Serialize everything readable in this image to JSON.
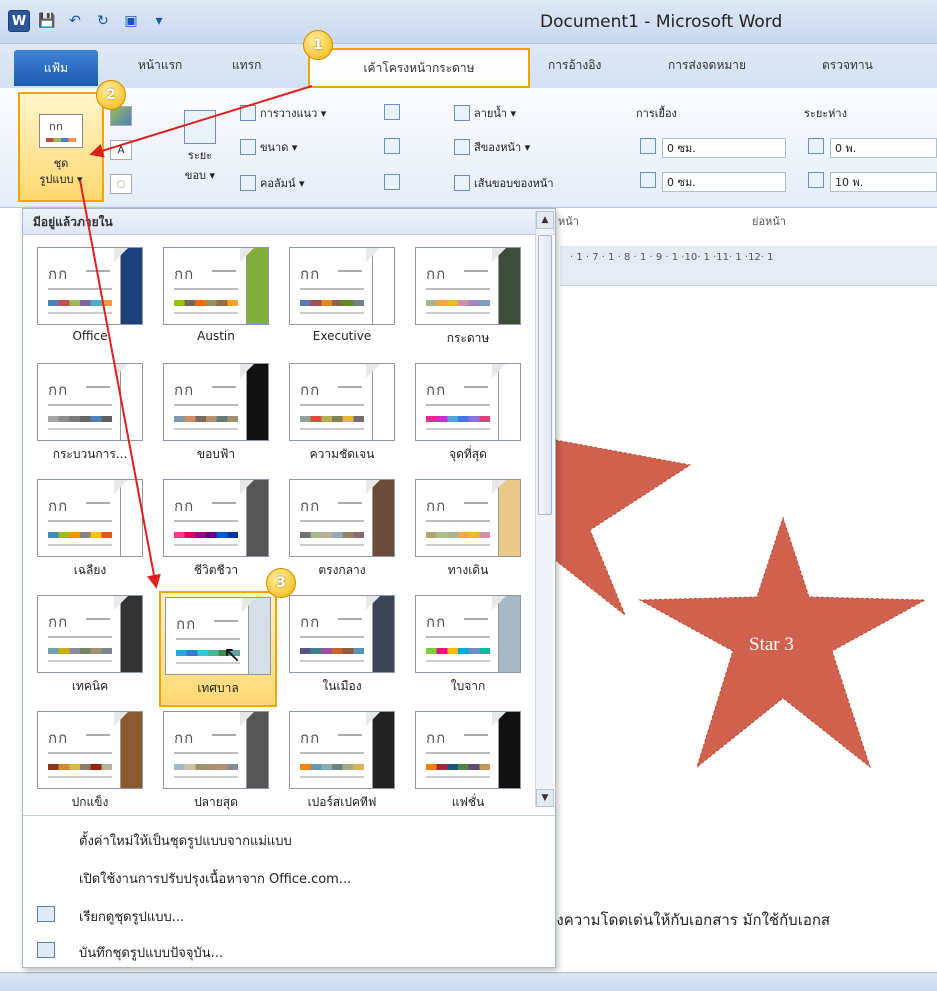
{
  "window": {
    "title": "Document1 - Microsoft Word",
    "app_icon": "W"
  },
  "tabs": {
    "file": "แฟ้ม",
    "home": "หน้าแรก",
    "insert": "แทรก",
    "page_layout": "เค้าโครงหน้ากระดาษ",
    "references": "การอ้างอิง",
    "mailings": "การส่งจดหมาย",
    "review": "ตรวจทาน"
  },
  "ribbon": {
    "themes_label": "ชุด รูปแบบ",
    "themes_line1": "ชุด",
    "themes_line2": "รูปแบบ ▾",
    "margins": "ระยะ ขอบ",
    "margins_line1": "ระยะ",
    "margins_line2": "ขอบ ▾",
    "orientation": "การวางแนว ▾",
    "size": "ขนาด ▾",
    "columns": "คอลัมน์ ▾",
    "watermark": "ลายน้ำ ▾",
    "page_color": "สีของหน้า ▾",
    "page_borders": "เส้นขอบของหน้า",
    "indent_label": "การเยื้อง",
    "spacing_label": "ระยะห่าง",
    "indent_left": "0 ซม.",
    "indent_right": "0 ซม.",
    "space_before": "0 พ.",
    "space_after": "10 พ.",
    "group_page_background_tail": "หน้า",
    "group_paragraph": "ย่อหน้า"
  },
  "gallery": {
    "header": "มีอยู่แล้วภายใน",
    "themes": [
      {
        "name": "Office",
        "fold": "#1f3f7a",
        "swatch": [
          "#4f81bd",
          "#c0504d",
          "#9bbb59",
          "#8064a2",
          "#4bacc6",
          "#f79646"
        ]
      },
      {
        "name": "Austin",
        "fold": "#7fae3a",
        "swatch": [
          "#94c600",
          "#71685a",
          "#ff6700",
          "#909465",
          "#956b43",
          "#fea022"
        ]
      },
      {
        "name": "Executive",
        "fold": "#ffffff",
        "swatch": [
          "#6076b4",
          "#9c5252",
          "#e68422",
          "#846648",
          "#63891f",
          "#758085"
        ]
      },
      {
        "name": "กระดาษ",
        "fold": "#3e4a3a",
        "swatch": [
          "#a5b592",
          "#f3a447",
          "#e7bc29",
          "#d092a7",
          "#9c85c0",
          "#809ec2"
        ]
      },
      {
        "name": "กระบวนการ...",
        "fold": "#ffffff",
        "swatch": [
          "#a5a5a5",
          "#8c8c8c",
          "#7a7a7a",
          "#666666",
          "#4f81bd",
          "#5f5f5f"
        ]
      },
      {
        "name": "ขอบฟ้า",
        "fold": "#111111",
        "swatch": [
          "#7e97ad",
          "#cc8e60",
          "#7a6a60",
          "#b4936d",
          "#67787b",
          "#9d936f"
        ]
      },
      {
        "name": "ความชัดเจน",
        "fold": "#ffffff",
        "swatch": [
          "#93a299",
          "#cf543f",
          "#b5ae53",
          "#848058",
          "#e8b54d",
          "#786c71"
        ]
      },
      {
        "name": "จุดที่สุด",
        "fold": "#ffffff",
        "swatch": [
          "#e32d91",
          "#c830cc",
          "#4ea6dc",
          "#4775e7",
          "#8971e1",
          "#d54773"
        ]
      },
      {
        "name": "เฉลียง",
        "fold": "#ffffff",
        "swatch": [
          "#418ab3",
          "#a6b727",
          "#f69200",
          "#838383",
          "#fec306",
          "#df5327"
        ]
      },
      {
        "name": "ชีวิตชีวา",
        "fold": "#555555",
        "swatch": [
          "#ff388c",
          "#e40059",
          "#9c007f",
          "#68007f",
          "#005bd3",
          "#00349e"
        ]
      },
      {
        "name": "ตรงกลาง",
        "fold": "#6b4c3a",
        "swatch": [
          "#6f6f74",
          "#a7b789",
          "#beae98",
          "#92a9b9",
          "#9c8265",
          "#8d6974"
        ]
      },
      {
        "name": "ทางเดิน",
        "fold": "#e8c98a",
        "swatch": [
          "#b6a272",
          "#b0bf8f",
          "#a5b592",
          "#f3a447",
          "#e7bc29",
          "#d092a7"
        ]
      },
      {
        "name": "เทคนิค",
        "fold": "#333333",
        "swatch": [
          "#6ea0b0",
          "#ccaf0a",
          "#8d89a4",
          "#748560",
          "#9e9273",
          "#7e848d"
        ]
      },
      {
        "name": "เทศบาล",
        "fold": "#d6dde5",
        "swatch": [
          "#1cade4",
          "#2683c6",
          "#27ced7",
          "#42ba97",
          "#3e8853",
          "#62a39f"
        ]
      },
      {
        "name": "ในเมือง",
        "fold": "#3a4656",
        "swatch": [
          "#53548a",
          "#438086",
          "#a04da3",
          "#c4652d",
          "#8b5d3d",
          "#5c92b5"
        ]
      },
      {
        "name": "ใบจาก",
        "fold": "#a9b8c6",
        "swatch": [
          "#7fd13b",
          "#ea157a",
          "#feb80a",
          "#00addc",
          "#738ac8",
          "#1ab39f"
        ]
      },
      {
        "name": "ปกแข็ง",
        "fold": "#8a5a2e",
        "swatch": [
          "#873624",
          "#d6862d",
          "#d0be40",
          "#877f6c",
          "#972109",
          "#aeb795"
        ]
      },
      {
        "name": "ปลายสุด",
        "fold": "#555555",
        "swatch": [
          "#9fb8cd",
          "#d2c0a3",
          "#9d936f",
          "#ac8e73",
          "#b58e76",
          "#868a97"
        ]
      },
      {
        "name": "เปอร์สเปคทีฟ",
        "fold": "#222222",
        "swatch": [
          "#ff8600",
          "#6997af",
          "#84acb6",
          "#6f8183",
          "#a5ab81",
          "#d8b25c"
        ]
      },
      {
        "name": "แฟชั่น",
        "fold": "#111111",
        "swatch": [
          "#f07f09",
          "#9f2936",
          "#1b587c",
          "#4e8542",
          "#604878",
          "#c19859"
        ]
      }
    ],
    "thumb_text": "กก",
    "selected_index": 13,
    "menu": {
      "reset": "ตั้งค่าใหม่ให้เป็นชุดรูปแบบจากแม่แบบ",
      "enable_updates": "เปิดใช้งานการปรับปรุงเนื้อหาจาก Office.com...",
      "browse": "เรียกดูชุดรูปแบบ...",
      "save": "บันทึกชุดรูปแบบปัจจุบัน..."
    }
  },
  "document": {
    "ruler": "· 1 · 7 · 1 · 8 · 1 · 9 · 1 ·10· 1 ·11· 1 ·12· 1",
    "shape_label": "Star 3",
    "star_color": "#d0624d",
    "body_text": "างความโดดเด่นให้กับเอกสาร มักใช้กับเอกส"
  },
  "badges": [
    "1",
    "2",
    "3"
  ],
  "colors": {
    "highlight_border": "#f0a500",
    "arrow": "#e02020"
  }
}
